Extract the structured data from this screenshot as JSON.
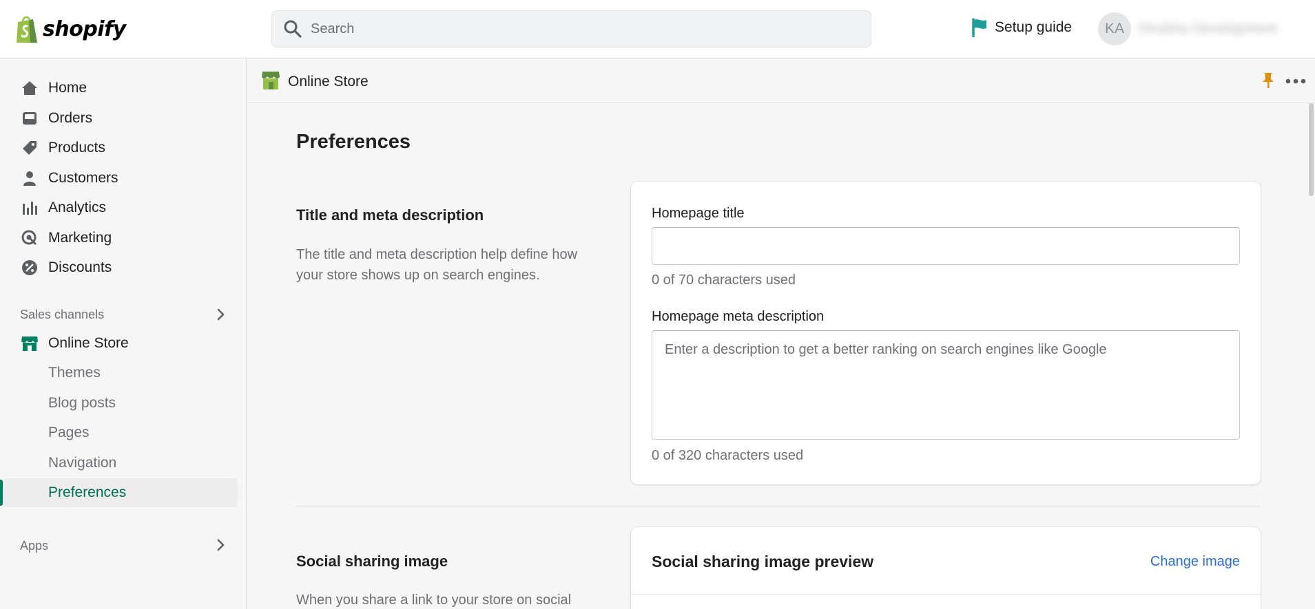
{
  "topbar": {
    "brand": "shopify",
    "search_placeholder": "Search",
    "setup_guide": "Setup guide",
    "avatar_initials": "KA",
    "store_name": "Shubha Development"
  },
  "sidebar": {
    "items": [
      {
        "label": "Home",
        "icon": "home-icon"
      },
      {
        "label": "Orders",
        "icon": "inbox-icon"
      },
      {
        "label": "Products",
        "icon": "tag-icon"
      },
      {
        "label": "Customers",
        "icon": "person-icon"
      },
      {
        "label": "Analytics",
        "icon": "bar-chart-icon"
      },
      {
        "label": "Marketing",
        "icon": "target-icon"
      },
      {
        "label": "Discounts",
        "icon": "discount-icon"
      }
    ],
    "sales_channels_label": "Sales channels",
    "online_store": "Online Store",
    "online_store_sub": [
      "Themes",
      "Blog posts",
      "Pages",
      "Navigation",
      "Preferences"
    ],
    "active_sub": "Preferences",
    "apps_label": "Apps"
  },
  "header": {
    "title": "Online Store"
  },
  "main": {
    "page_title": "Preferences",
    "title_meta": {
      "heading": "Title and meta description",
      "description": "The title and meta description help define how your store shows up on search engines.",
      "homepage_title_label": "Homepage title",
      "homepage_title_value": "",
      "homepage_title_help": "0 of 70 characters used",
      "meta_label": "Homepage meta description",
      "meta_placeholder": "Enter a description to get a better ranking on search engines like Google",
      "meta_help": "0 of 320 characters used"
    },
    "social": {
      "heading": "Social sharing image",
      "description": "When you share a link to your store on social",
      "card_title": "Social sharing image preview",
      "change_link": "Change image"
    }
  },
  "colors": {
    "accent_green": "#008060",
    "link_blue": "#2c6ecb",
    "pin_orange": "#e08e0b"
  }
}
